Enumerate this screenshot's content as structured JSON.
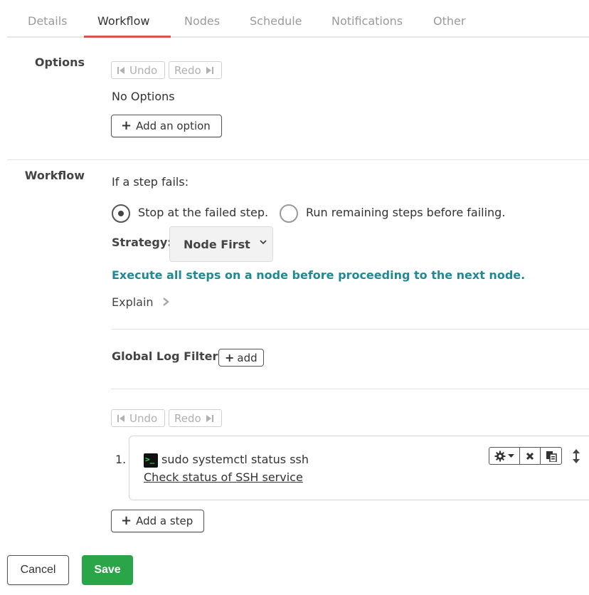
{
  "tabs": [
    {
      "label": "Details",
      "active": false
    },
    {
      "label": "Workflow",
      "active": true
    },
    {
      "label": "Nodes",
      "active": false
    },
    {
      "label": "Schedule",
      "active": false
    },
    {
      "label": "Notifications",
      "active": false
    },
    {
      "label": "Other",
      "active": false
    }
  ],
  "options": {
    "label": "Options",
    "undo_label": "Undo",
    "redo_label": "Redo",
    "empty_text": "No Options",
    "add_option_label": "Add an option"
  },
  "workflow": {
    "label": "Workflow",
    "if_fails_label": "If a step fails:",
    "radio_stop_label": "Stop at the failed step.",
    "radio_run_label": "Run remaining steps before failing.",
    "radio_selected": "stop",
    "strategy_label": "Strategy:",
    "strategy_value": "Node First",
    "strategy_description": "Execute all steps on a node before proceeding to the next node.",
    "explain_label": "Explain",
    "log_filters_label": "Global Log Filters",
    "add_filter_label": "add",
    "undo_label": "Undo",
    "redo_label": "Redo",
    "steps": [
      {
        "number": "1.",
        "command": "sudo systemctl status ssh",
        "description": "Check status of SSH service"
      }
    ],
    "add_step_label": "Add a step"
  },
  "footer": {
    "cancel_label": "Cancel",
    "save_label": "Save"
  },
  "colors": {
    "accent_tab": "#d9534f",
    "teal_text": "#1f8a93",
    "save_green": "#2aa548"
  }
}
